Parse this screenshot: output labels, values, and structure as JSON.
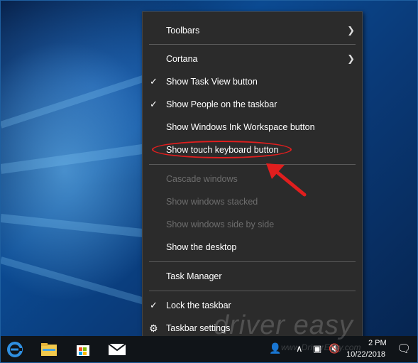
{
  "menu": {
    "toolbars": "Toolbars",
    "cortana": "Cortana",
    "show_task_view": "Show Task View button",
    "show_people": "Show People on the taskbar",
    "show_ink": "Show Windows Ink Workspace button",
    "show_touch_keyboard": "Show touch keyboard button",
    "cascade": "Cascade windows",
    "stacked": "Show windows stacked",
    "side_by_side": "Show windows side by side",
    "show_desktop": "Show the desktop",
    "task_manager": "Task Manager",
    "lock_taskbar": "Lock the taskbar",
    "taskbar_settings": "Taskbar settings"
  },
  "tray": {
    "time": "2 PM",
    "date": "10/22/2018"
  },
  "watermark": {
    "brand": "driver easy",
    "url": "www.DriverEasy.com"
  },
  "colors": {
    "menu_bg": "#2b2b2b",
    "highlight": "#e01e1e",
    "taskbar_bg": "#101418"
  }
}
